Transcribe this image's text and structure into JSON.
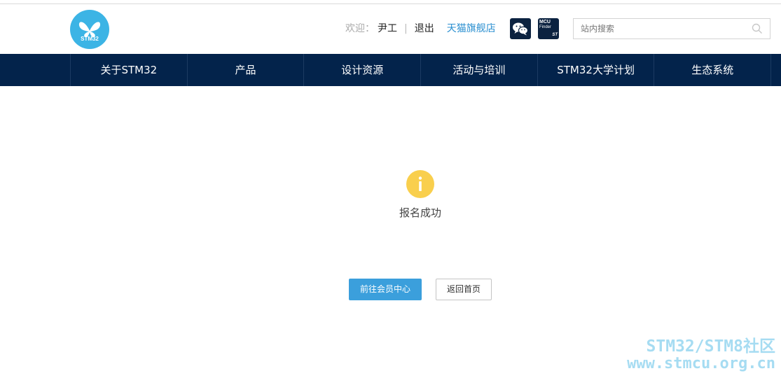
{
  "header": {
    "logo_text": "STM32",
    "welcome": "欢迎：",
    "username": "尹工",
    "separator": "|",
    "logout": "退出",
    "store_link": "天猫旗舰店",
    "wechat_icon": "wechat-icon",
    "mcu_finder": {
      "line1": "MCU",
      "line2": "Finder",
      "brand": "ST"
    }
  },
  "search": {
    "placeholder": "站内搜索",
    "value": ""
  },
  "nav": {
    "items": [
      {
        "label": "关于STM32"
      },
      {
        "label": "产品"
      },
      {
        "label": "设计资源"
      },
      {
        "label": "活动与培训"
      },
      {
        "label": "STM32大学计划"
      },
      {
        "label": "生态系统"
      }
    ]
  },
  "main": {
    "message": "报名成功",
    "primary_button": "前往会员中心",
    "secondary_button": "返回首页"
  },
  "watermark": {
    "line1": "STM32/STM8社区",
    "line2": "www.stmcu.org.cn"
  },
  "colors": {
    "nav_bg": "#03234b",
    "accent": "#3b9fdc",
    "logo": "#3cb4e5",
    "info_icon": "#f9cf4d"
  }
}
